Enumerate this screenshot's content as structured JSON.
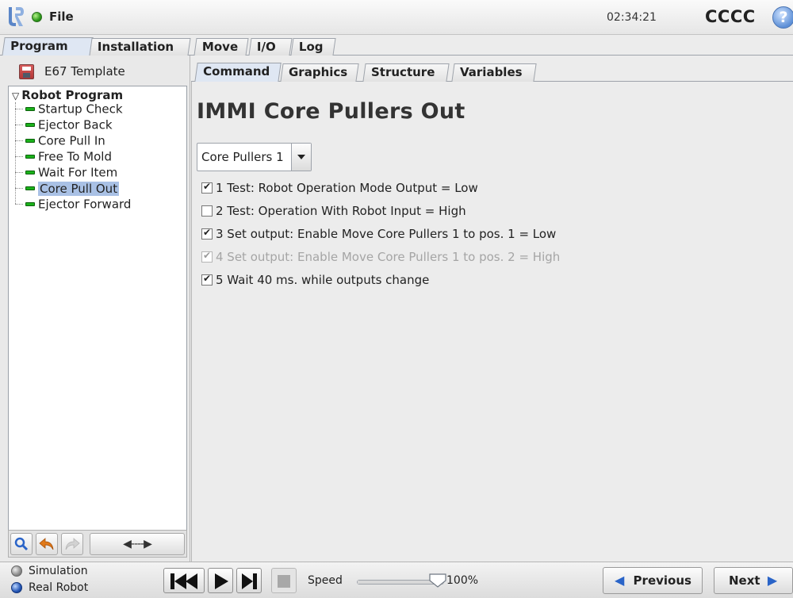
{
  "header": {
    "file_label": "File",
    "clock": "02:34:21",
    "robot_name": "CCCC",
    "help_glyph": "?"
  },
  "main_tabs": [
    {
      "label": "Program",
      "active": true
    },
    {
      "label": "Installation",
      "active": false
    },
    {
      "label": "Move",
      "active": false
    },
    {
      "label": "I/O",
      "active": false
    },
    {
      "label": "Log",
      "active": false
    }
  ],
  "program": {
    "name": "E67 Template",
    "tree_root": "Robot Program",
    "tree_items": [
      {
        "label": "Startup Check",
        "selected": false
      },
      {
        "label": "Ejector Back",
        "selected": false
      },
      {
        "label": "Core Pull In",
        "selected": false
      },
      {
        "label": "Free To Mold",
        "selected": false
      },
      {
        "label": "Wait For Item",
        "selected": false
      },
      {
        "label": "Core Pull Out",
        "selected": true
      },
      {
        "label": "Ejector Forward",
        "selected": false
      }
    ],
    "toolbar": {
      "move_glyph": "◀----▶"
    }
  },
  "sub_tabs": [
    {
      "label": "Command",
      "active": true
    },
    {
      "label": "Graphics",
      "active": false
    },
    {
      "label": "Structure",
      "active": false
    },
    {
      "label": "Variables",
      "active": false
    }
  ],
  "command": {
    "title": "IMMI Core Pullers Out",
    "select_value": "Core Pullers 1",
    "conditions": [
      {
        "text": "1 Test: Robot Operation Mode Output = Low",
        "checked": true,
        "enabled": true
      },
      {
        "text": "2 Test: Operation With Robot Input = High",
        "checked": false,
        "enabled": true
      },
      {
        "text": "3 Set output: Enable Move Core Pullers 1 to pos. 1 = Low",
        "checked": true,
        "enabled": true
      },
      {
        "text": "4 Set output: Enable Move Core Pullers 1 to pos. 2 = High",
        "checked": true,
        "enabled": false
      },
      {
        "text": "5 Wait 40 ms. while outputs change",
        "checked": true,
        "enabled": true
      }
    ]
  },
  "footer": {
    "mode_simulation": "Simulation",
    "mode_real": "Real Robot",
    "speed_label": "Speed",
    "speed_value": "100%",
    "speed_fraction": 1.0,
    "previous_label": "Previous",
    "next_label": "Next"
  },
  "colors": {
    "accent": "#2a64c8",
    "selection": "#a9c1e5",
    "command_node": "#1ab21a",
    "status_ok": "#2d9a1a"
  }
}
